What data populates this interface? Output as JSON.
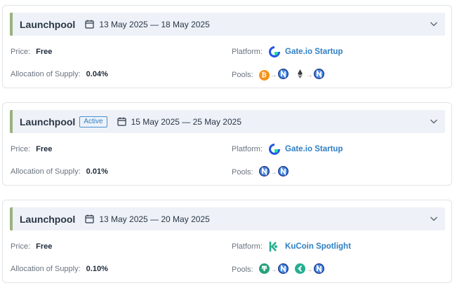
{
  "cards": [
    {
      "title": "Launchpool",
      "badge": "",
      "dates": "13 May 2025 — 18 May 2025",
      "price_label": "Price:",
      "price": "Free",
      "alloc_label": "Allocation of Supply:",
      "alloc": "0.04%",
      "platform_label": "Platform:",
      "platform": "Gate.io Startup",
      "platform_icon": "gateio-logo-icon",
      "pools_label": "Pools:",
      "pools": [
        {
          "from": "bitcoin-icon",
          "to": "nexus-token-icon"
        },
        {
          "from": "ethereum-icon",
          "to": "nexus-token-icon"
        }
      ]
    },
    {
      "title": "Launchpool",
      "badge": "Active",
      "dates": "15 May 2025 — 25 May 2025",
      "price_label": "Price:",
      "price": "Free",
      "alloc_label": "Allocation of Supply:",
      "alloc": "0.01%",
      "platform_label": "Platform:",
      "platform": "Gate.io Startup",
      "platform_icon": "gateio-logo-icon",
      "pools_label": "Pools:",
      "pools": [
        {
          "from": "nexus-token-icon",
          "to": "nexus-token-icon"
        }
      ]
    },
    {
      "title": "Launchpool",
      "badge": "",
      "dates": "13 May 2025 — 20 May 2025",
      "price_label": "Price:",
      "price": "Free",
      "alloc_label": "Allocation of Supply:",
      "alloc": "0.10%",
      "platform_label": "Platform:",
      "platform": "KuCoin Spotlight",
      "platform_icon": "kucoin-logo-icon",
      "pools_label": "Pools:",
      "pools": [
        {
          "from": "tether-icon",
          "to": "nexus-token-icon"
        },
        {
          "from": "kucoin-token-icon",
          "to": "nexus-token-icon"
        }
      ]
    }
  ],
  "colors": {
    "accent_bar": "#9bb07f",
    "link_blue": "#2f7fc4",
    "header_bg": "#eef2f8"
  }
}
